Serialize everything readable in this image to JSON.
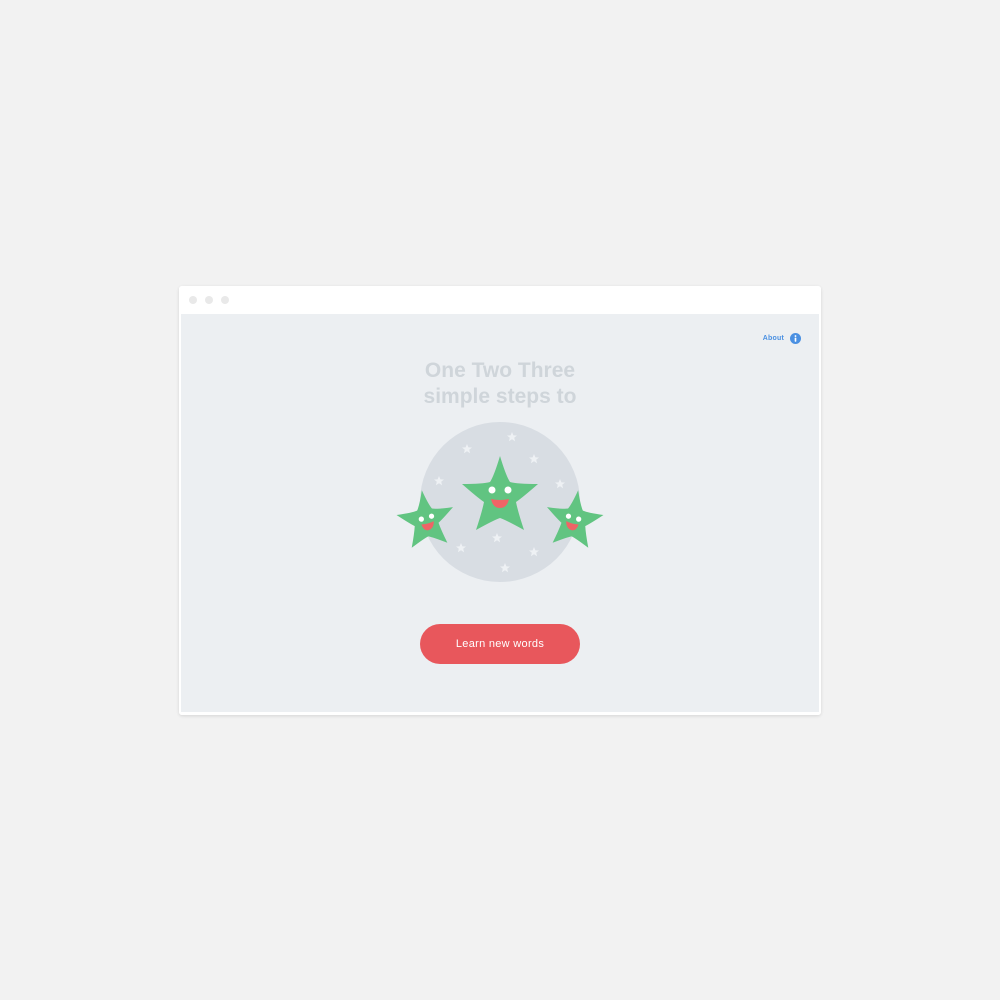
{
  "window": {
    "controls": [
      "close-dot",
      "minimize-dot",
      "maximize-dot"
    ]
  },
  "header": {
    "about_label": "About",
    "about_icon": "info-icon"
  },
  "hero": {
    "title_line1": "One Two Three",
    "title_line2": "simple steps to",
    "illustration_icons": [
      "star-character-icon",
      "star-character-icon",
      "star-character-icon"
    ]
  },
  "cta": {
    "label": "Learn new words"
  },
  "colors": {
    "page_background": "#f2f2f2",
    "content_background": "#eceff2",
    "title_text": "#cfd5da",
    "link_blue": "#4a90e2",
    "cta_red": "#e8575c",
    "star_green": "#61c481",
    "mouth_red": "#ef6466",
    "circle_grey": "#d8dde3"
  }
}
